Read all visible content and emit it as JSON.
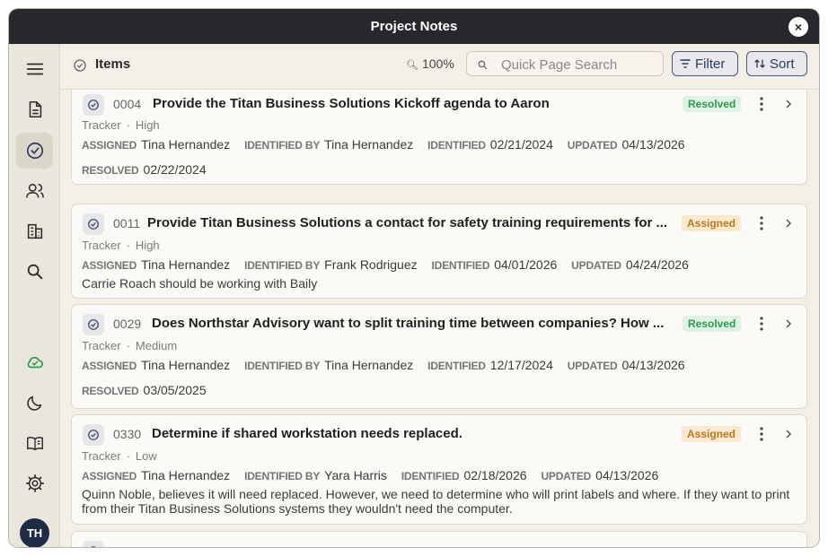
{
  "window": {
    "title": "Project Notes",
    "close_label": "×"
  },
  "sidebar": {
    "items": [
      {
        "name": "menu-icon"
      },
      {
        "name": "document-icon"
      },
      {
        "name": "check-circle-icon",
        "active": true
      },
      {
        "name": "users-icon"
      },
      {
        "name": "building-icon"
      },
      {
        "name": "search-icon"
      },
      {
        "name": "cloud-sync-icon"
      },
      {
        "name": "moon-icon"
      },
      {
        "name": "book-icon"
      },
      {
        "name": "gear-icon"
      }
    ],
    "avatar_initials": "TH"
  },
  "toolbar": {
    "title": "Items",
    "zoom": "100%",
    "search_placeholder": "Quick Page Search",
    "filter_label": "Filter",
    "sort_label": "Sort"
  },
  "labels": {
    "assigned": "ASSIGNED",
    "identified_by": "IDENTIFIED BY",
    "identified": "IDENTIFIED",
    "updated": "UPDATED",
    "resolved": "RESOLVED",
    "separator": "·"
  },
  "items": [
    {
      "number": "0004",
      "title": "Provide the Titan Business Solutions Kickoff agenda to Aaron",
      "status": "Resolved",
      "type": "Tracker",
      "priority": "High",
      "assigned": "Tina Hernandez",
      "identified_by": "Tina Hernandez",
      "identified": "02/21/2024",
      "updated": "04/13/2026",
      "resolved": "02/22/2024",
      "note": ""
    },
    {
      "number": "0011",
      "title": "Provide Titan Business Solutions a contact for safety training requirements for ...",
      "status": "Assigned",
      "type": "Tracker",
      "priority": "High",
      "assigned": "Tina Hernandez",
      "identified_by": "Frank Rodriguez",
      "identified": "04/01/2026",
      "updated": "04/24/2026",
      "resolved": "",
      "note": "Carrie Roach should be working with Baily"
    },
    {
      "number": "0029",
      "title": "Does Northstar Advisory want to split training time between companies? How ...",
      "status": "Resolved",
      "type": "Tracker",
      "priority": "Medium",
      "assigned": "Tina Hernandez",
      "identified_by": "Tina Hernandez",
      "identified": "12/17/2024",
      "updated": "04/13/2026",
      "resolved": "03/05/2025",
      "note": ""
    },
    {
      "number": "0330",
      "title": "Determine if shared workstation needs replaced.",
      "status": "Assigned",
      "type": "Tracker",
      "priority": "Low",
      "assigned": "Tina Hernandez",
      "identified_by": "Yara Harris",
      "identified": "02/18/2026",
      "updated": "04/13/2026",
      "resolved": "",
      "note": "Quinn Noble, believes it will need replaced. However, we need to determine who will print labels and where. If they want to print from their Titan Business Solutions systems they wouldn't need the computer."
    }
  ]
}
